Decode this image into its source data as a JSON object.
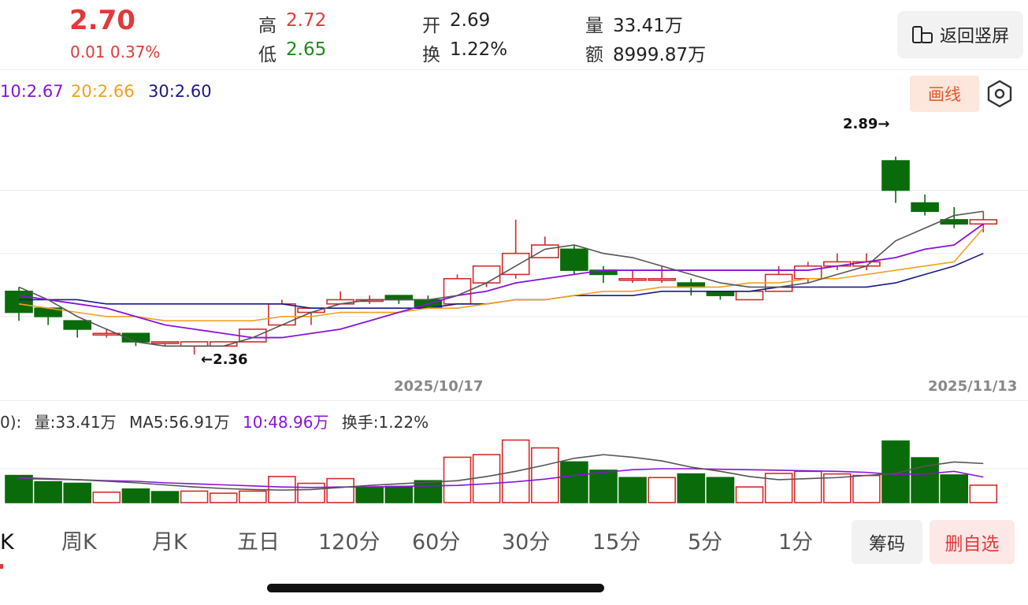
{
  "quote": {
    "price": "2.70",
    "change": "0.01 0.37%",
    "high_label": "高",
    "high": "2.72",
    "low_label": "低",
    "low": "2.65",
    "open_label": "开",
    "open": "2.69",
    "turnover_label": "换",
    "turnover": "1.22%",
    "volume_label": "量",
    "volume": "33.41万",
    "amount_label": "额",
    "amount": "8999.87万"
  },
  "buttons": {
    "portrait": "返回竖屏",
    "draw": "画线"
  },
  "ma_legend": {
    "ma10": "10:2.67",
    "ma20": "20:2.66",
    "ma30": "30:2.60"
  },
  "chart_annotations": {
    "high_mark": "2.89→",
    "low_mark": "←2.36"
  },
  "dates": {
    "mid": "2025/10/17",
    "end": "2025/11/13"
  },
  "volume_legend": {
    "prefix": "0):",
    "volume": "量:33.41万",
    "ma5": "MA5:56.91万",
    "ma10": "10:48.96万",
    "turnover": "换手:1.22%"
  },
  "tabs": [
    "K",
    "周K",
    "月K",
    "五日",
    "120分",
    "60分",
    "30分",
    "15分",
    "5分",
    "1分"
  ],
  "side_buttons": {
    "chips": "筹码",
    "remove": "删自选"
  },
  "colors": {
    "up": "#d42b2b",
    "down": "#0a6b0a",
    "ma5": "#555555",
    "ma10": "#8a12d9",
    "ma20": "#f0a020",
    "ma30": "#1a1a8a"
  },
  "chart_data": {
    "type": "candlestick",
    "candles": [
      {
        "o": 2.51,
        "c": 2.46,
        "h": 2.52,
        "l": 2.44
      },
      {
        "o": 2.47,
        "c": 2.45,
        "h": 2.47,
        "l": 2.43
      },
      {
        "o": 2.44,
        "c": 2.42,
        "h": 2.44,
        "l": 2.4
      },
      {
        "o": 2.41,
        "c": 2.41,
        "h": 2.42,
        "l": 2.4
      },
      {
        "o": 2.41,
        "c": 2.39,
        "h": 2.41,
        "l": 2.38
      },
      {
        "o": 2.39,
        "c": 2.39,
        "h": 2.39,
        "l": 2.38
      },
      {
        "o": 2.38,
        "c": 2.39,
        "h": 2.39,
        "l": 2.36
      },
      {
        "o": 2.38,
        "c": 2.39,
        "h": 2.39,
        "l": 2.38
      },
      {
        "o": 2.39,
        "c": 2.42,
        "h": 2.42,
        "l": 2.39
      },
      {
        "o": 2.43,
        "c": 2.48,
        "h": 2.49,
        "l": 2.43
      },
      {
        "o": 2.46,
        "c": 2.47,
        "h": 2.47,
        "l": 2.43
      },
      {
        "o": 2.48,
        "c": 2.49,
        "h": 2.51,
        "l": 2.48
      },
      {
        "o": 2.49,
        "c": 2.49,
        "h": 2.5,
        "l": 2.48
      },
      {
        "o": 2.5,
        "c": 2.49,
        "h": 2.5,
        "l": 2.48
      },
      {
        "o": 2.49,
        "c": 2.47,
        "h": 2.5,
        "l": 2.47
      },
      {
        "o": 2.48,
        "c": 2.54,
        "h": 2.55,
        "l": 2.48
      },
      {
        "o": 2.53,
        "c": 2.57,
        "h": 2.57,
        "l": 2.52
      },
      {
        "o": 2.55,
        "c": 2.6,
        "h": 2.68,
        "l": 2.54
      },
      {
        "o": 2.59,
        "c": 2.62,
        "h": 2.64,
        "l": 2.59
      },
      {
        "o": 2.61,
        "c": 2.56,
        "h": 2.62,
        "l": 2.55
      },
      {
        "o": 2.56,
        "c": 2.55,
        "h": 2.57,
        "l": 2.53
      },
      {
        "o": 2.54,
        "c": 2.54,
        "h": 2.56,
        "l": 2.53
      },
      {
        "o": 2.54,
        "c": 2.54,
        "h": 2.57,
        "l": 2.53
      },
      {
        "o": 2.53,
        "c": 2.52,
        "h": 2.54,
        "l": 2.5
      },
      {
        "o": 2.51,
        "c": 2.5,
        "h": 2.51,
        "l": 2.49
      },
      {
        "o": 2.49,
        "c": 2.51,
        "h": 2.51,
        "l": 2.49
      },
      {
        "o": 2.51,
        "c": 2.55,
        "h": 2.57,
        "l": 2.51
      },
      {
        "o": 2.54,
        "c": 2.57,
        "h": 2.58,
        "l": 2.53
      },
      {
        "o": 2.57,
        "c": 2.58,
        "h": 2.6,
        "l": 2.56
      },
      {
        "o": 2.57,
        "c": 2.58,
        "h": 2.6,
        "l": 2.56
      },
      {
        "o": 2.82,
        "c": 2.75,
        "h": 2.83,
        "l": 2.72
      },
      {
        "o": 2.72,
        "c": 2.7,
        "h": 2.74,
        "l": 2.69
      },
      {
        "o": 2.68,
        "c": 2.67,
        "h": 2.71,
        "l": 2.66
      },
      {
        "o": 2.67,
        "c": 2.68,
        "h": 2.7,
        "l": 2.65
      }
    ],
    "ma5": [
      2.52,
      2.49,
      2.45,
      2.42,
      2.39,
      2.38,
      2.38,
      2.38,
      2.4,
      2.43,
      2.46,
      2.48,
      2.49,
      2.49,
      2.49,
      2.5,
      2.53,
      2.57,
      2.61,
      2.62,
      2.6,
      2.59,
      2.57,
      2.55,
      2.53,
      2.52,
      2.52,
      2.53,
      2.55,
      2.57,
      2.63,
      2.66,
      2.69,
      2.7
    ],
    "ma10": [
      2.5,
      2.49,
      2.48,
      2.47,
      2.45,
      2.43,
      2.42,
      2.41,
      2.4,
      2.4,
      2.41,
      2.42,
      2.44,
      2.46,
      2.48,
      2.5,
      2.51,
      2.53,
      2.54,
      2.55,
      2.56,
      2.56,
      2.56,
      2.56,
      2.56,
      2.56,
      2.56,
      2.56,
      2.57,
      2.58,
      2.59,
      2.61,
      2.62,
      2.67
    ],
    "ma20": [
      2.48,
      2.47,
      2.46,
      2.45,
      2.45,
      2.44,
      2.44,
      2.44,
      2.44,
      2.45,
      2.45,
      2.46,
      2.46,
      2.46,
      2.47,
      2.47,
      2.48,
      2.49,
      2.49,
      2.5,
      2.51,
      2.51,
      2.52,
      2.52,
      2.52,
      2.53,
      2.53,
      2.54,
      2.54,
      2.55,
      2.56,
      2.57,
      2.58,
      2.66
    ],
    "ma30": [
      2.49,
      2.49,
      2.49,
      2.48,
      2.48,
      2.48,
      2.48,
      2.48,
      2.48,
      2.48,
      2.47,
      2.47,
      2.47,
      2.47,
      2.47,
      2.48,
      2.48,
      2.49,
      2.49,
      2.5,
      2.5,
      2.5,
      2.51,
      2.51,
      2.51,
      2.51,
      2.52,
      2.52,
      2.52,
      2.52,
      2.53,
      2.55,
      2.57,
      2.6
    ],
    "y_range": [
      2.33,
      2.91
    ],
    "gridlines": [
      2.45,
      2.6,
      2.75
    ],
    "volume": [
      52,
      40,
      37,
      20,
      26,
      21,
      22,
      18,
      22,
      50,
      37,
      46,
      30,
      31,
      42,
      87,
      92,
      120,
      105,
      78,
      62,
      48,
      48,
      55,
      48,
      30,
      56,
      60,
      55,
      52,
      118,
      86,
      53,
      33.41
    ],
    "volume_up": [
      false,
      false,
      false,
      true,
      false,
      false,
      true,
      true,
      true,
      true,
      true,
      true,
      false,
      false,
      false,
      true,
      true,
      true,
      true,
      false,
      false,
      false,
      true,
      false,
      false,
      true,
      true,
      true,
      true,
      true,
      false,
      false,
      false,
      true
    ],
    "vol_ma5": [
      48,
      46,
      44,
      41,
      38,
      34,
      30,
      27,
      25,
      24,
      25,
      29,
      33,
      36,
      39,
      42,
      50,
      60,
      72,
      85,
      92,
      87,
      80,
      68,
      60,
      50,
      44,
      46,
      48,
      52,
      56,
      70,
      78,
      75
    ],
    "vol_ma10": [
      46,
      45,
      44,
      42,
      41,
      38,
      36,
      34,
      32,
      30,
      29,
      30,
      30,
      31,
      32,
      33,
      36,
      40,
      45,
      52,
      58,
      63,
      65,
      65,
      64,
      63,
      62,
      61,
      60,
      58,
      54,
      55,
      60,
      48.96
    ],
    "vol_range": [
      0,
      130
    ],
    "x_labels": [
      "2025/10/17",
      "2025/11/13"
    ]
  }
}
